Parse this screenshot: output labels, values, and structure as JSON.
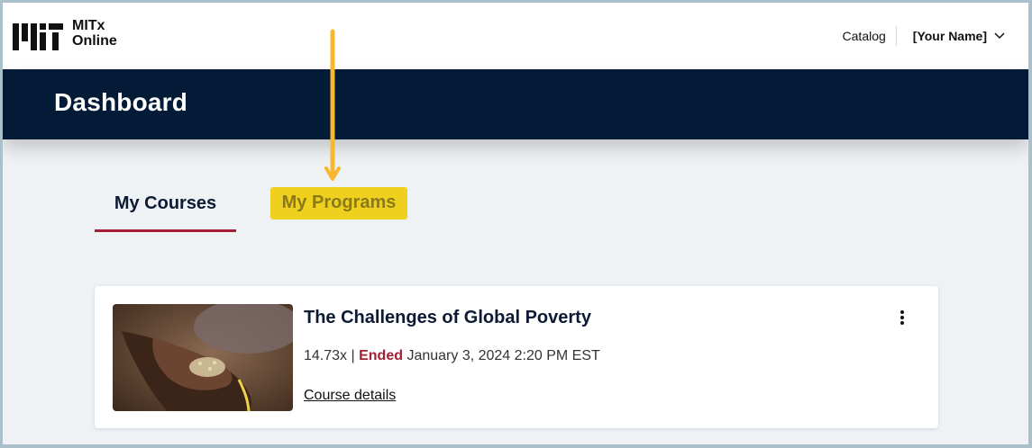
{
  "header": {
    "logo_line1": "MITx",
    "logo_line2": "Online",
    "catalog_label": "Catalog",
    "user_label": "[Your Name]"
  },
  "banner": {
    "title": "Dashboard"
  },
  "tabs": [
    {
      "label": "My Courses",
      "active": true
    },
    {
      "label": "My Programs",
      "active": false
    }
  ],
  "course": {
    "title": "The Challenges of Global Poverty",
    "id_code": "14.73x",
    "separator": "|",
    "status": "Ended",
    "date": "January 3, 2024 2:20 PM EST",
    "details_link": "Course details"
  },
  "colors": {
    "banner_bg": "#041b38",
    "accent_red": "#a31f34",
    "highlight_yellow": "#f0d01e",
    "annotation_arrow": "#f7b731"
  }
}
